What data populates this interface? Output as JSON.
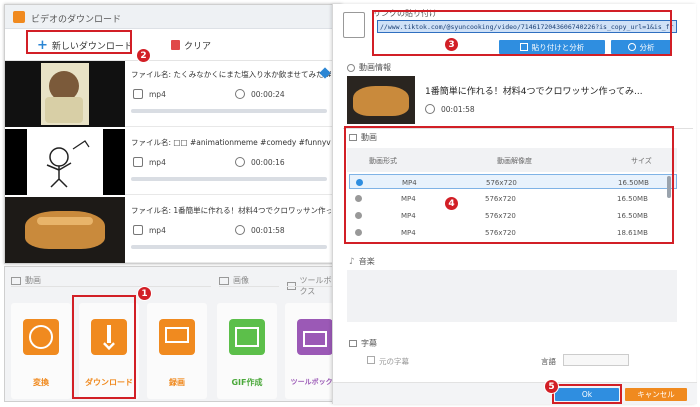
{
  "left_window": {
    "title": "ビデオのダウンロード",
    "new_download_label": "新しいダウンロード",
    "clear_label": "クリア"
  },
  "downloads": [
    {
      "filename": "ファイル名: たくみなかくにまた塩入り水か飲ませてみた #オセロ",
      "format": "mp4",
      "duration": "00:00:24"
    },
    {
      "filename": "ファイル名: □□ #animationmeme #comedy #funnyvideos #m",
      "format": "mp4",
      "duration": "00:00:16"
    },
    {
      "filename": "ファイル名: 1番簡単に作れる！材料4つでクロワッサン作ってみませんか",
      "format": "mp4",
      "duration": "00:01:58"
    }
  ],
  "home": {
    "sections": {
      "video": "動画",
      "image": "画像",
      "toolbox": "ツールボックス"
    },
    "tiles": [
      {
        "label": "変換",
        "color": "#f08a1f",
        "icon": "film-convert-icon"
      },
      {
        "label": "ダウンロード",
        "color": "#f08a1f",
        "icon": "download-arrow-icon"
      },
      {
        "label": "録画",
        "color": "#f08a1f",
        "icon": "screen-record-icon"
      },
      {
        "label": "GIF作成",
        "color": "#5cbf4a",
        "icon": "gif-image-icon"
      },
      {
        "label": "ツールボックス",
        "color": "#9b59b6",
        "icon": "toolbox-icon"
      }
    ]
  },
  "right_panel": {
    "paste_header": "リンクの貼り付け",
    "url_value": "//www.tiktok.com/@syuncooking/video/7146172043606740226?is_copy_url=1&is_from_webapp=v1",
    "paste_analyze_label": "貼り付けと分析",
    "analyze_label": "分析",
    "video_info_header": "動画情報",
    "video_title": "1番簡単に作れる！材料4つでクロワッサン作ってみ...",
    "video_duration": "00:01:58",
    "video_section": "動画",
    "col_format": "動画形式",
    "col_resolution": "動画解像度",
    "col_size": "サイズ",
    "rows": [
      {
        "format": "MP4",
        "resolution": "576x720",
        "size": "16.50MB",
        "selected": true
      },
      {
        "format": "MP4",
        "resolution": "576x720",
        "size": "16.50MB",
        "selected": false
      },
      {
        "format": "MP4",
        "resolution": "576x720",
        "size": "16.50MB",
        "selected": false
      },
      {
        "format": "MP4",
        "resolution": "576x720",
        "size": "18.61MB",
        "selected": false
      }
    ],
    "music_section": "音楽",
    "subtitle_section": "字幕",
    "original_subtitle_label": "元の字幕",
    "language_label": "言語",
    "ok_label": "Ok",
    "cancel_label": "キャンセル"
  },
  "badges": [
    "1",
    "2",
    "3",
    "4",
    "5"
  ],
  "colors": {
    "accent_red": "#d21f26",
    "accent_blue": "#2f8ee0",
    "orange": "#f08a1f"
  }
}
